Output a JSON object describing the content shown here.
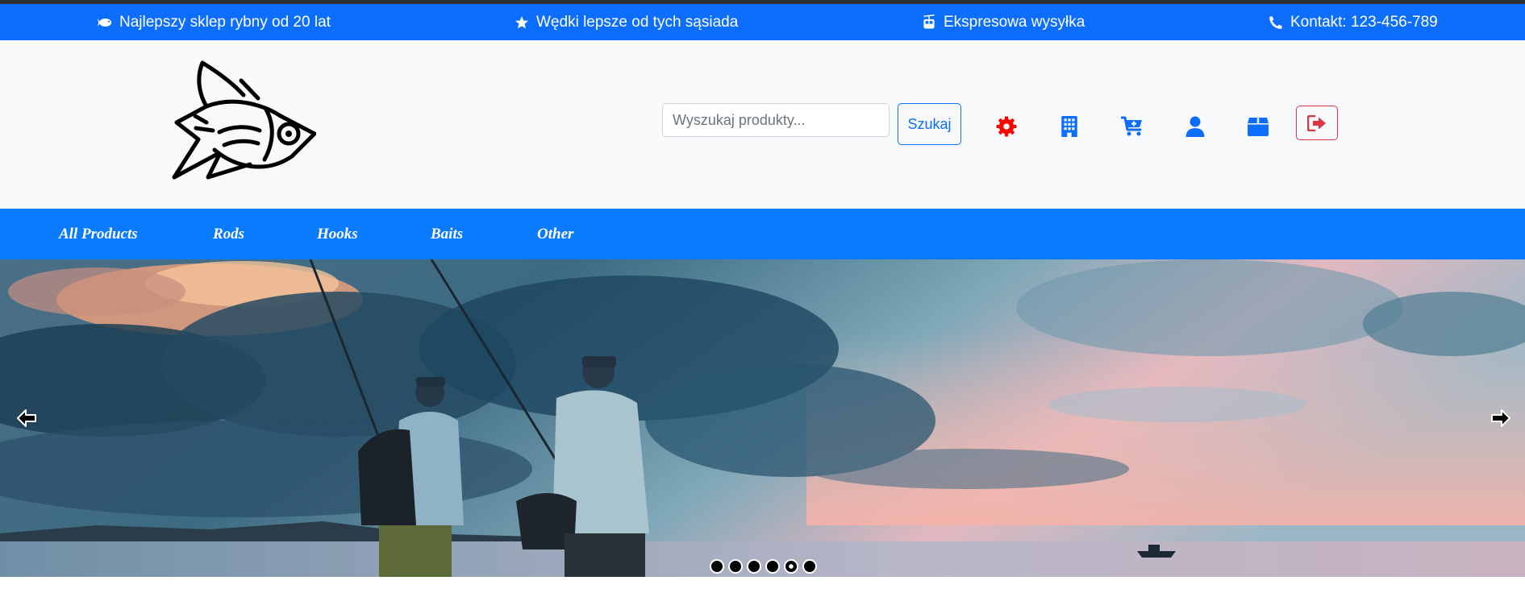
{
  "topbar": {
    "items": [
      {
        "icon": "fish-icon",
        "text": "Najlepszy sklep rybny od 20 lat"
      },
      {
        "icon": "star-icon",
        "text": "Wędki lepsze od tych sąsiada"
      },
      {
        "icon": "cable-car-icon",
        "text": "Ekspresowa wysyłka"
      },
      {
        "icon": "phone-icon",
        "text": "Kontakt: 123-456-789"
      }
    ]
  },
  "header": {
    "logo_icon": "fish-logo",
    "search": {
      "placeholder": "Wyszukaj produkty...",
      "value": ""
    },
    "search_button": "Szukaj",
    "icons": [
      "gear-icon",
      "building-icon",
      "cart-plus-icon",
      "user-icon",
      "box-icon",
      "sign-out-icon"
    ]
  },
  "nav": {
    "links": [
      "All Products",
      "Rods",
      "Hooks",
      "Baits",
      "Other"
    ]
  },
  "carousel": {
    "slide_count": 6,
    "active_index": 4,
    "prev_icon": "arrow-left-icon",
    "next_icon": "arrow-right-icon"
  },
  "colors": {
    "primary": "#0d6efd",
    "nav": "#0a7bff",
    "header_bg": "#f8f9fa",
    "danger": "#dc3545",
    "gear": "#ff0000"
  }
}
